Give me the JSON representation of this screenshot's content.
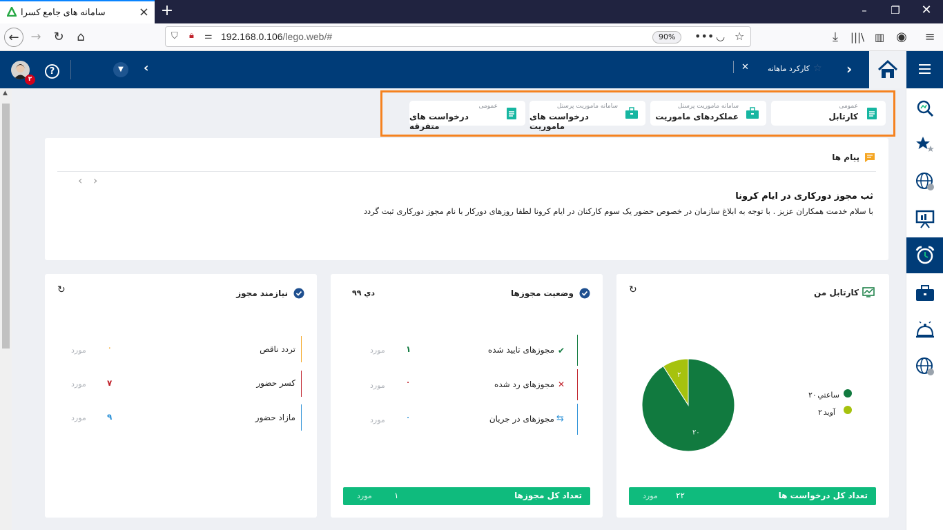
{
  "browser": {
    "tab_title": "سامانه های جامع کسرا",
    "url_host": "192.168.0.106",
    "url_path": "/lego.web/#",
    "zoom": "90%"
  },
  "header": {
    "breadcrumb_item": "کارکرد ماهانه",
    "notification_count": "۲"
  },
  "shortcuts": [
    {
      "sub": "عمومی",
      "label": "کارتابل"
    },
    {
      "sub": "سامانه ماموریت پرسنل",
      "label": "عملکردهای ماموریت"
    },
    {
      "sub": "سامانه ماموریت پرسنل",
      "label": "درخواست های ماموریت"
    },
    {
      "sub": "عمومی",
      "label": "درخواست های متفرقه"
    }
  ],
  "messages": {
    "title": "پیام ها",
    "headline": "ثب مجوز دورکاری در ایام کرونا",
    "body": "با سلام خدمت همکاران عزیز  . با توجه به ابلاغ سازمان در خصوص حضور یک سوم کارکنان در ایام کرونا لطفا روزهای دورکار با نام مجوز دورکاری ثبت گردد"
  },
  "cartable": {
    "title": "کارتابل من",
    "legend": [
      {
        "name": "ساعتي",
        "value": "۲۰",
        "color": "#117a3f"
      },
      {
        "name": "آويد",
        "value": "۲",
        "color": "#a6c20e"
      }
    ],
    "footer_label": "تعداد کل درخواست ها",
    "footer_value": "۲۲",
    "footer_unit": "مورد"
  },
  "chart_data": {
    "type": "pie",
    "categories": [
      "ساعتي",
      "آويد"
    ],
    "values": [
      20,
      2
    ],
    "labels": [
      "۲۰",
      "۲"
    ],
    "colors": [
      "#117a3f",
      "#a6c20e"
    ]
  },
  "permits": {
    "title": "وضعیت مجوزها",
    "date": "دي ۹۹",
    "rows": [
      {
        "label": "مجوزهای تایید شده",
        "value": "۱",
        "unit": "مورد",
        "icon": "check-icon",
        "color": "#117a3f"
      },
      {
        "label": "مجوزهای رد شده",
        "value": "۰",
        "unit": "مورد",
        "icon": "cross-icon",
        "color": "#c0222b"
      },
      {
        "label": "مجوزهای در جریان",
        "value": "۰",
        "unit": "مورد",
        "icon": "transfer-icon",
        "color": "#2f93d8"
      }
    ],
    "footer_label": "تعداد کل مجوزها",
    "footer_value": "۱",
    "footer_unit": "مورد"
  },
  "needs": {
    "title": "نیازمند مجوز",
    "rows": [
      {
        "label": "تردد ناقص",
        "value": "۰",
        "unit": "مورد",
        "color": "#f5a623"
      },
      {
        "label": "کسر حضور",
        "value": "۷",
        "unit": "مورد",
        "color": "#c0222b"
      },
      {
        "label": "مازاد حضور",
        "value": "۹",
        "unit": "مورد",
        "color": "#2f93d8"
      }
    ]
  }
}
